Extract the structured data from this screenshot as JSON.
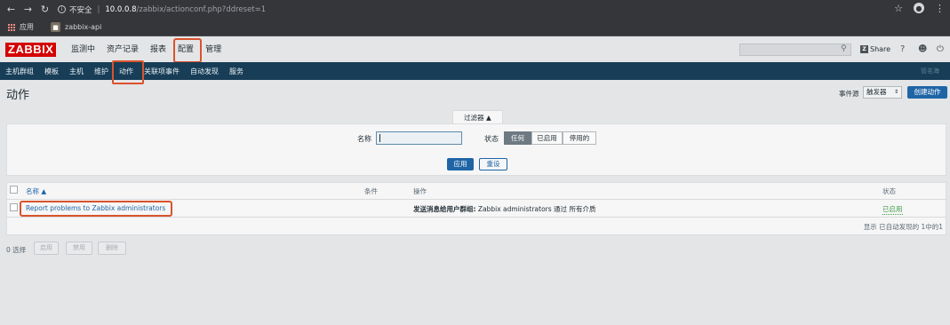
{
  "browser": {
    "security_label": "不安全",
    "url_host": "10.0.0.8",
    "url_path": "/zabbix/actionconf.php?ddreset=1",
    "bookmarks": [
      {
        "label": "应用"
      },
      {
        "label": "zabbix-api"
      }
    ]
  },
  "header": {
    "logo": "ZABBIX",
    "menu": [
      "监测中",
      "资产记录",
      "报表",
      "配置",
      "管理"
    ],
    "selected_menu": "配置",
    "share_label": "Share",
    "help": "?"
  },
  "submenu": {
    "items": [
      "主机群组",
      "模板",
      "主机",
      "维护",
      "动作",
      "关联项事件",
      "自动发现",
      "服务"
    ],
    "active": "动作",
    "right_text": "管名海"
  },
  "page": {
    "title": "动作",
    "event_source_label": "事件源",
    "event_source_value": "触发器",
    "create_button": "创建动作"
  },
  "filter": {
    "tab_label": "过滤器 ▲",
    "name_label": "名称",
    "name_value": "",
    "status_label": "状态",
    "status_options": [
      "任何",
      "已启用",
      "停用的"
    ],
    "status_selected": "任何",
    "apply": "应用",
    "reset": "重设"
  },
  "table": {
    "headers": {
      "name": "名称 ▲",
      "conditions": "条件",
      "operations": "操作",
      "status": "状态"
    },
    "rows": [
      {
        "name": "Report problems to Zabbix administrators",
        "conditions": "",
        "operations_bold": "发送消息给用户群组:",
        "operations_rest": " Zabbix administrators 通过 所有介质",
        "status": "已启用"
      }
    ],
    "footer": "显示 已自动发现的 1中的1"
  },
  "mass": {
    "selected": "0 选择",
    "buttons": [
      "启用",
      "禁用",
      "删除"
    ]
  }
}
